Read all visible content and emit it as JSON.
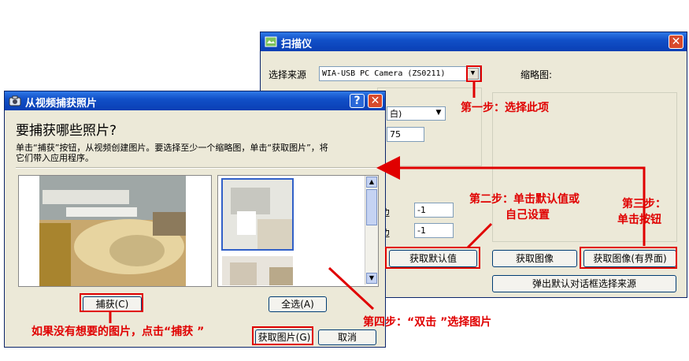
{
  "scanner": {
    "title": "扫描仪",
    "source_label": "选择来源",
    "source_value": "WIA-USB PC Camera (ZS0211)",
    "thumbnail_label": "缩略图:",
    "color_value": "白)",
    "field1_value": "75",
    "edge1_label": "边",
    "edge1_value": "-1",
    "edge2_label": "边",
    "edge2_value": "-1",
    "default_button": "获取默认值",
    "get_image_button": "获取图像",
    "get_image_ui_button": "获取图像(有界面)",
    "dialog_source_button": "弹出默认对话框选择来源"
  },
  "capture": {
    "title": "从视频捕获照片",
    "heading": "要捕获哪些照片?",
    "desc_line1": "单击“捕获”按钮，从视频创建图片。要选择至少一个缩略图，单击“获取图片”，将",
    "desc_line2": "它们带入应用程序。",
    "help": "?",
    "close": "✕",
    "capture_button": "捕获(C)",
    "select_all_button": "全选(A)",
    "get_pictures_button": "获取图片(G)",
    "cancel_button": "取消"
  },
  "annotations": {
    "step1": "第一步：选择此项",
    "step2_line1": "第二步：单击默认值或",
    "step2_line2": "自己设置",
    "step3_line1": "第三步：",
    "step3_line2": "单击按钮",
    "step4": "第四步：“双击 ”选择图片",
    "capture_hint": "如果没有想要的图片，点击“捕获 ”"
  },
  "colors": {
    "annotation": "#e00000",
    "titlebar": "#1150c8",
    "dialog_bg": "#ece9d8"
  }
}
